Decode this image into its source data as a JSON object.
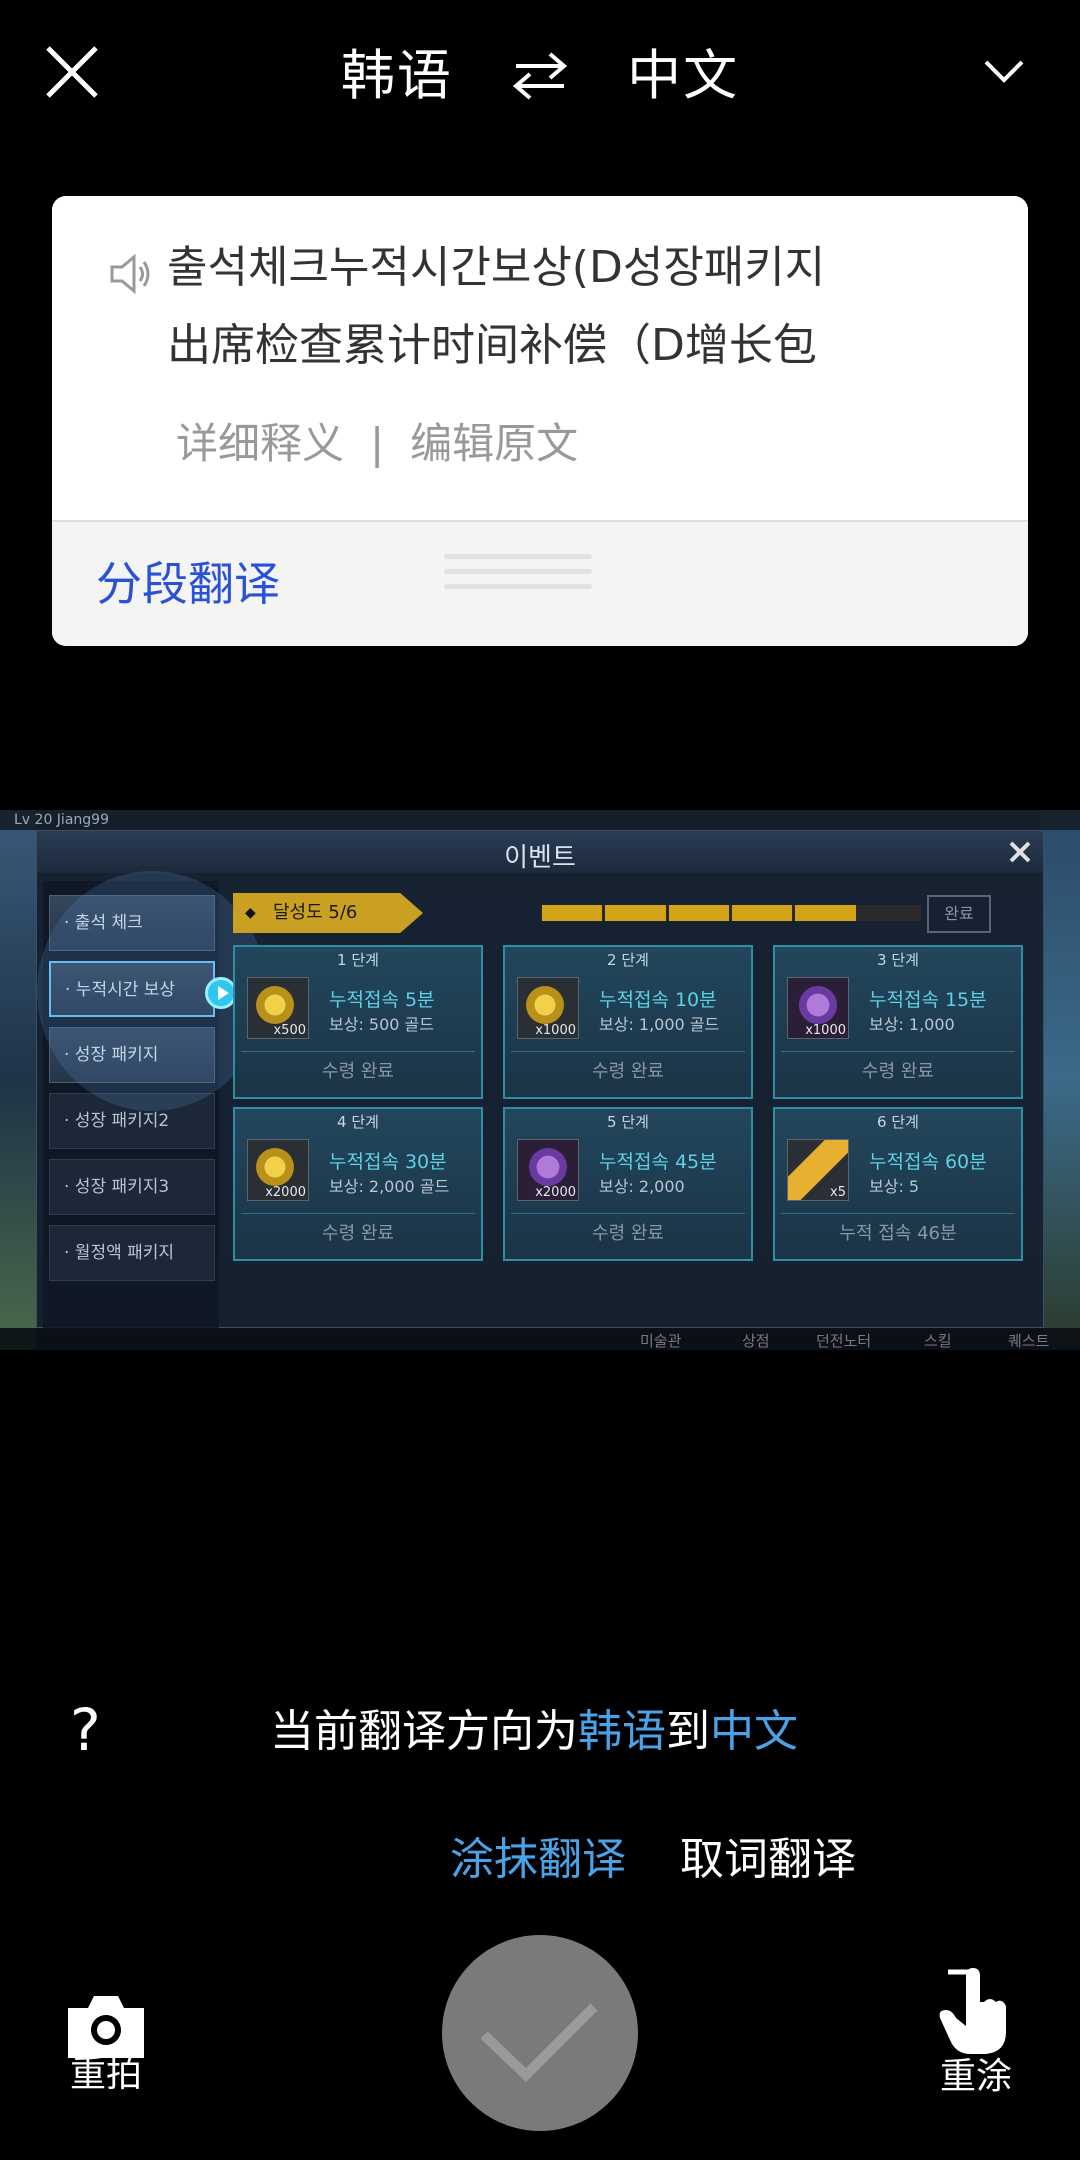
{
  "header": {
    "source_lang": "韩语",
    "target_lang": "中文"
  },
  "result_card": {
    "source_text": "출석체크누적시간보상(D성장패키지",
    "translated_text": "出席检查累计时间补偿（D增长包",
    "detail_link": "详细释义",
    "separator": "|",
    "edit_link": "编辑原文",
    "segment_button": "分段翻译"
  },
  "captured_image": {
    "top_strip_text": "Lv 20 Jiang99",
    "panel_title": "이벤트",
    "menu": [
      {
        "label": "· 출석 체크"
      },
      {
        "label": "· 누적시간 보상"
      },
      {
        "label": "· 성장 패키지"
      },
      {
        "label": "· 성장 패키지2"
      },
      {
        "label": "· 성장 패키지3"
      },
      {
        "label": "· 월정액 패키지"
      }
    ],
    "progress_label": "달성도 5/6",
    "progress": {
      "completed": 5,
      "total": 6
    },
    "done_badge": "완료",
    "tiles": [
      {
        "stage": "1 단계",
        "name": "누적접속 5분",
        "reward": "보상: 500 골드",
        "qty": "x500",
        "status": "수령 완료",
        "icon": "gold-coin-icon"
      },
      {
        "stage": "2 단계",
        "name": "누적접속 10분",
        "reward": "보상: 1,000 골드",
        "qty": "x1000",
        "status": "수령 완료",
        "icon": "gold-coin-icon"
      },
      {
        "stage": "3 단계",
        "name": "누적접속 15분",
        "reward": "보상: 1,000",
        "qty": "x1000",
        "status": "수령 완료",
        "icon": "purple-gem-icon"
      },
      {
        "stage": "4 단계",
        "name": "누적접속 30분",
        "reward": "보상: 2,000 골드",
        "qty": "x2000",
        "status": "수령 완료",
        "icon": "gold-coin-icon"
      },
      {
        "stage": "5 단계",
        "name": "누적접속 45분",
        "reward": "보상: 2,000",
        "qty": "x2000",
        "status": "수령 완료",
        "icon": "purple-gem-icon"
      },
      {
        "stage": "6 단계",
        "name": "누적접속 60분",
        "reward": "보상: 5",
        "qty": "x5",
        "status": "누적 접속 46분",
        "icon": "golden-key-icon"
      }
    ],
    "bottom_tabs": [
      "미술관",
      "상점",
      "던전노터",
      "스킬",
      "퀘스트"
    ]
  },
  "bottom": {
    "help": "?",
    "direction_prefix": "当前翻译方向为",
    "direction_src": "韩语",
    "direction_mid": "到",
    "direction_dst": "中文",
    "mode_smear": "涂抹翻译",
    "mode_word": "取词翻译",
    "retake_label": "重拍",
    "repaint_label": "重涂"
  },
  "colors": {
    "accent_blue": "#4aa3e8",
    "link_blue": "#2a52d6",
    "confirm_gray": "#7a7a7a"
  }
}
